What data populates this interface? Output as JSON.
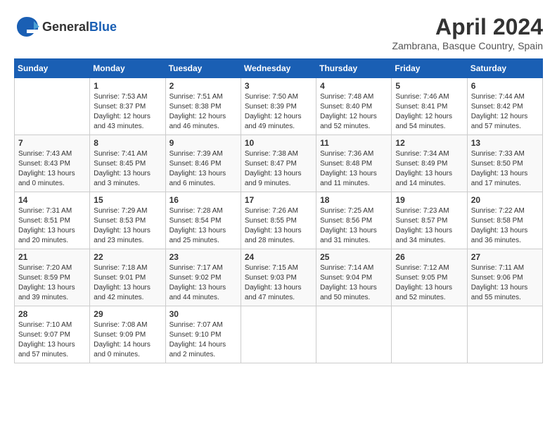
{
  "header": {
    "logo_general": "General",
    "logo_blue": "Blue",
    "month": "April 2024",
    "location": "Zambrana, Basque Country, Spain"
  },
  "days_of_week": [
    "Sunday",
    "Monday",
    "Tuesday",
    "Wednesday",
    "Thursday",
    "Friday",
    "Saturday"
  ],
  "weeks": [
    [
      {
        "day": "",
        "info": ""
      },
      {
        "day": "1",
        "info": "Sunrise: 7:53 AM\nSunset: 8:37 PM\nDaylight: 12 hours\nand 43 minutes."
      },
      {
        "day": "2",
        "info": "Sunrise: 7:51 AM\nSunset: 8:38 PM\nDaylight: 12 hours\nand 46 minutes."
      },
      {
        "day": "3",
        "info": "Sunrise: 7:50 AM\nSunset: 8:39 PM\nDaylight: 12 hours\nand 49 minutes."
      },
      {
        "day": "4",
        "info": "Sunrise: 7:48 AM\nSunset: 8:40 PM\nDaylight: 12 hours\nand 52 minutes."
      },
      {
        "day": "5",
        "info": "Sunrise: 7:46 AM\nSunset: 8:41 PM\nDaylight: 12 hours\nand 54 minutes."
      },
      {
        "day": "6",
        "info": "Sunrise: 7:44 AM\nSunset: 8:42 PM\nDaylight: 12 hours\nand 57 minutes."
      }
    ],
    [
      {
        "day": "7",
        "info": "Sunrise: 7:43 AM\nSunset: 8:43 PM\nDaylight: 13 hours\nand 0 minutes."
      },
      {
        "day": "8",
        "info": "Sunrise: 7:41 AM\nSunset: 8:45 PM\nDaylight: 13 hours\nand 3 minutes."
      },
      {
        "day": "9",
        "info": "Sunrise: 7:39 AM\nSunset: 8:46 PM\nDaylight: 13 hours\nand 6 minutes."
      },
      {
        "day": "10",
        "info": "Sunrise: 7:38 AM\nSunset: 8:47 PM\nDaylight: 13 hours\nand 9 minutes."
      },
      {
        "day": "11",
        "info": "Sunrise: 7:36 AM\nSunset: 8:48 PM\nDaylight: 13 hours\nand 11 minutes."
      },
      {
        "day": "12",
        "info": "Sunrise: 7:34 AM\nSunset: 8:49 PM\nDaylight: 13 hours\nand 14 minutes."
      },
      {
        "day": "13",
        "info": "Sunrise: 7:33 AM\nSunset: 8:50 PM\nDaylight: 13 hours\nand 17 minutes."
      }
    ],
    [
      {
        "day": "14",
        "info": "Sunrise: 7:31 AM\nSunset: 8:51 PM\nDaylight: 13 hours\nand 20 minutes."
      },
      {
        "day": "15",
        "info": "Sunrise: 7:29 AM\nSunset: 8:53 PM\nDaylight: 13 hours\nand 23 minutes."
      },
      {
        "day": "16",
        "info": "Sunrise: 7:28 AM\nSunset: 8:54 PM\nDaylight: 13 hours\nand 25 minutes."
      },
      {
        "day": "17",
        "info": "Sunrise: 7:26 AM\nSunset: 8:55 PM\nDaylight: 13 hours\nand 28 minutes."
      },
      {
        "day": "18",
        "info": "Sunrise: 7:25 AM\nSunset: 8:56 PM\nDaylight: 13 hours\nand 31 minutes."
      },
      {
        "day": "19",
        "info": "Sunrise: 7:23 AM\nSunset: 8:57 PM\nDaylight: 13 hours\nand 34 minutes."
      },
      {
        "day": "20",
        "info": "Sunrise: 7:22 AM\nSunset: 8:58 PM\nDaylight: 13 hours\nand 36 minutes."
      }
    ],
    [
      {
        "day": "21",
        "info": "Sunrise: 7:20 AM\nSunset: 8:59 PM\nDaylight: 13 hours\nand 39 minutes."
      },
      {
        "day": "22",
        "info": "Sunrise: 7:18 AM\nSunset: 9:01 PM\nDaylight: 13 hours\nand 42 minutes."
      },
      {
        "day": "23",
        "info": "Sunrise: 7:17 AM\nSunset: 9:02 PM\nDaylight: 13 hours\nand 44 minutes."
      },
      {
        "day": "24",
        "info": "Sunrise: 7:15 AM\nSunset: 9:03 PM\nDaylight: 13 hours\nand 47 minutes."
      },
      {
        "day": "25",
        "info": "Sunrise: 7:14 AM\nSunset: 9:04 PM\nDaylight: 13 hours\nand 50 minutes."
      },
      {
        "day": "26",
        "info": "Sunrise: 7:12 AM\nSunset: 9:05 PM\nDaylight: 13 hours\nand 52 minutes."
      },
      {
        "day": "27",
        "info": "Sunrise: 7:11 AM\nSunset: 9:06 PM\nDaylight: 13 hours\nand 55 minutes."
      }
    ],
    [
      {
        "day": "28",
        "info": "Sunrise: 7:10 AM\nSunset: 9:07 PM\nDaylight: 13 hours\nand 57 minutes."
      },
      {
        "day": "29",
        "info": "Sunrise: 7:08 AM\nSunset: 9:09 PM\nDaylight: 14 hours\nand 0 minutes."
      },
      {
        "day": "30",
        "info": "Sunrise: 7:07 AM\nSunset: 9:10 PM\nDaylight: 14 hours\nand 2 minutes."
      },
      {
        "day": "",
        "info": ""
      },
      {
        "day": "",
        "info": ""
      },
      {
        "day": "",
        "info": ""
      },
      {
        "day": "",
        "info": ""
      }
    ]
  ]
}
